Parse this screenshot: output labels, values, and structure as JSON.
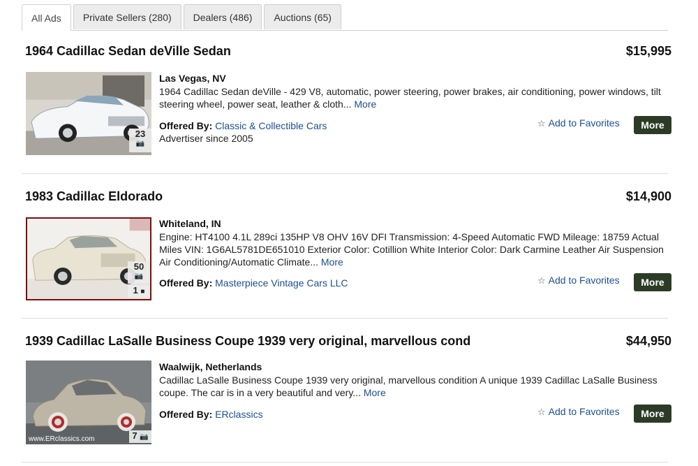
{
  "tabs": [
    {
      "label": "All Ads",
      "active": true
    },
    {
      "label": "Private Sellers (280)",
      "active": false
    },
    {
      "label": "Dealers (486)",
      "active": false
    },
    {
      "label": "Auctions (65)",
      "active": false
    }
  ],
  "labels": {
    "more_link": "More",
    "offered_by": "Offered By:",
    "add_to_favorites": "Add to Favorites",
    "more_button": "More"
  },
  "icons": {
    "favorite": "star-icon",
    "photos": "camera-icon",
    "videos": "video-icon"
  },
  "colors": {
    "link": "#1b4f91",
    "button": "#2c3b26"
  },
  "listings": [
    {
      "title": "1964 Cadillac Sedan deVille Sedan",
      "price": "$15,995",
      "location": "Las Vegas, NV",
      "description": "1964 Cadillac Sedan deVille - 429 V8, automatic, power steering, power brakes, air conditioning, power windows, tilt steering wheel, power seat, leather & cloth...",
      "seller": "Classic & Collectible Cars",
      "advertiser_since": "Advertiser since 2005",
      "photo_count": "23"
    },
    {
      "title": "1983 Cadillac Eldorado",
      "price": "$14,900",
      "location": "Whiteland, IN",
      "description": "Engine: HT4100 4.1L 289ci 135HP V8 OHV 16V DFI Transmission: 4-Speed Automatic FWD Mileage: 18759 Actual Miles VIN: 1G6AL5781DE651010 Exterior Color: Cotillion White Interior Color: Dark Carmine Leather Air Suspension Air Conditioning/Automatic Climate...",
      "seller": "Masterpiece Vintage Cars LLC",
      "photo_count": "50",
      "video_count": "1"
    },
    {
      "title": "1939 Cadillac LaSalle Business Coupe 1939 very original, marvellous cond",
      "price": "$44,950",
      "location": "Waalwijk, Netherlands",
      "description": "Cadillac LaSalle Business Coupe 1939 very original, marvellous condition   A unique 1939 Cadillac LaSalle Business coupe. The car is in a very beautiful and very...",
      "seller": "ERclassics",
      "photo_count": "7",
      "watermark": "www.ERclassics.com"
    }
  ]
}
